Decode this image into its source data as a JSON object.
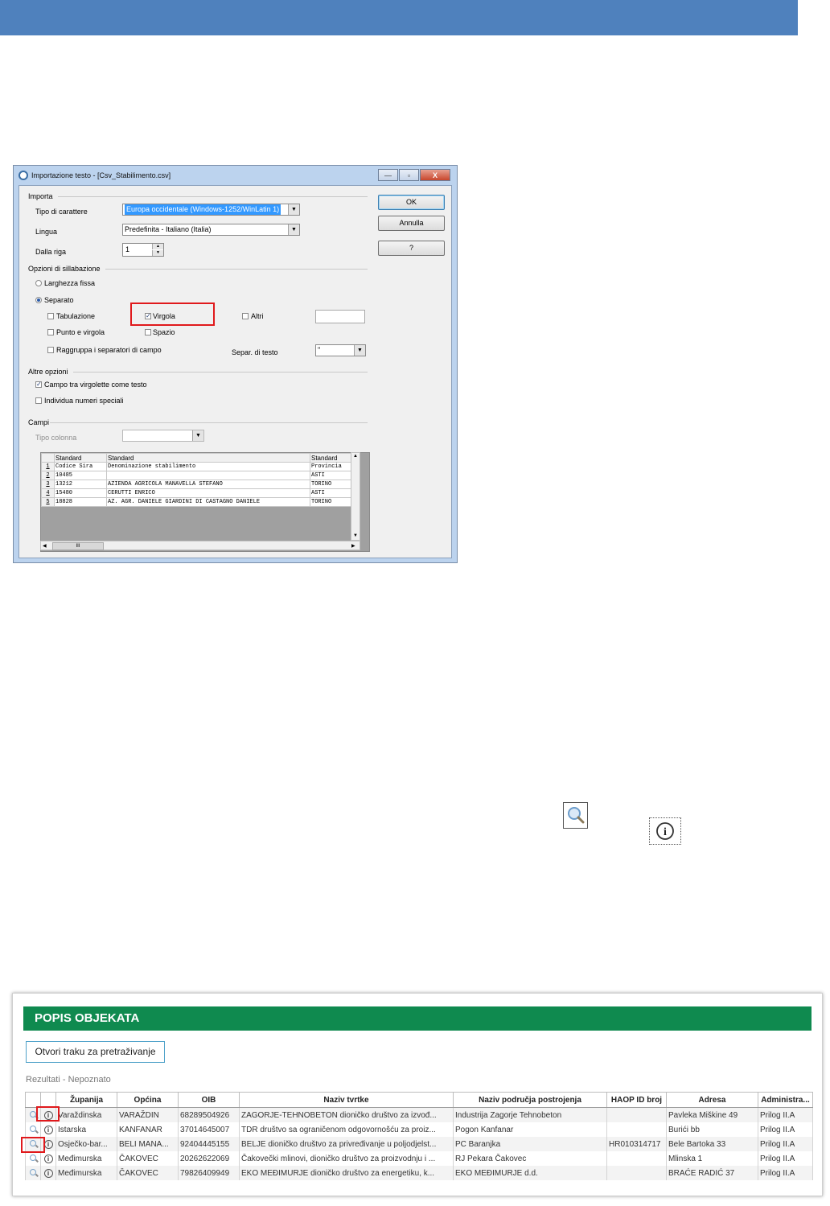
{
  "dialog": {
    "title": "Importazione testo - [Csv_Stabilimento.csv]",
    "window_buttons": {
      "minimize": "—",
      "maximize": "▫",
      "close": "X"
    },
    "importa": {
      "section": "Importa",
      "charset_label": "Tipo di carattere",
      "charset_value": "Europa occidentale (Windows-1252/WinLatin 1)",
      "language_label": "Lingua",
      "language_value": "Predefinita - Italiano (Italia)",
      "from_row_label": "Dalla riga",
      "from_row_value": "1"
    },
    "buttons": {
      "ok": "OK",
      "cancel": "Annulla",
      "help": "?"
    },
    "separator_options": {
      "section": "Opzioni di sillabazione",
      "fixed_width": "Larghezza fissa",
      "separated": "Separato",
      "tab": "Tabulazione",
      "comma": "Virgola",
      "other": "Altri",
      "semicolon": "Punto e virgola",
      "space": "Spazio",
      "merge": "Raggruppa i separatori di campo",
      "text_sep_label": "Separ. di testo",
      "text_sep_value": "\""
    },
    "other_options": {
      "section": "Altre opzioni",
      "quoted_as_text": "Campo tra virgolette come testo",
      "detect_special": "Individua numeri speciali"
    },
    "fields": {
      "section": "Campi",
      "column_type_label": "Tipo colonna"
    },
    "preview": {
      "headers": [
        "Standard",
        "Standard",
        "Standard"
      ],
      "rows": [
        {
          "n": "1",
          "cells": [
            "Codice Sira",
            "Denominazione stabilimento",
            "Provincia"
          ]
        },
        {
          "n": "2",
          "cells": [
            "10485",
            "",
            "ASTI"
          ]
        },
        {
          "n": "3",
          "cells": [
            "13212",
            "AZIENDA AGRICOLA MANAVELLA STEFANO",
            "TORINO"
          ]
        },
        {
          "n": "4",
          "cells": [
            "15480",
            "CERUTTI ENRICO",
            "ASTI"
          ]
        },
        {
          "n": "5",
          "cells": [
            "18828",
            "AZ. AGR. DANIELE GIARDINI DI CASTAGNO DANIELE",
            "TORINO"
          ]
        }
      ],
      "hscroll_grip": "III"
    }
  },
  "popis": {
    "title": "POPIS OBJEKATA",
    "search_button": "Otvori traku za pretraživanje",
    "results_label": "Rezultati - Nepoznato",
    "columns": [
      "",
      "",
      "Županija",
      "Općina",
      "OIB",
      "Naziv tvrtke",
      "Naziv područja postrojenja",
      "HAOP ID broj",
      "Adresa",
      "Administra..."
    ],
    "rows": [
      {
        "zupanija": "Varaždinska",
        "opcina": "VARAŽDIN",
        "oib": "68289504926",
        "naziv": "ZAGORJE-TEHNOBETON dioničko društvo za izvođ...",
        "podrucje": "Industrija Zagorje Tehnobeton",
        "haop": "",
        "adresa": "Pavleka Miškine 49",
        "admin": "Prilog II.A"
      },
      {
        "zupanija": "Istarska",
        "opcina": "KANFANAR",
        "oib": "37014645007",
        "naziv": "TDR društvo sa ograničenom odgovornošću za proiz...",
        "podrucje": "Pogon Kanfanar",
        "haop": "",
        "adresa": "Burići bb",
        "admin": "Prilog II.A"
      },
      {
        "zupanija": "Osječko-bar...",
        "opcina": "BELI MANA...",
        "oib": "92404445155",
        "naziv": "BELJE dioničko društvo za privređivanje u poljodjelst...",
        "podrucje": "PC Baranjka",
        "haop": "HR010314717",
        "adresa": "Bele Bartoka 33",
        "admin": "Prilog II.A"
      },
      {
        "zupanija": "Međimurska",
        "opcina": "ČAKOVEC",
        "oib": "20262622069",
        "naziv": "Čakovečki mlinovi, dioničko društvo za proizvodnju i ...",
        "podrucje": "RJ Pekara Čakovec",
        "haop": "",
        "adresa": "Mlinska 1",
        "admin": "Prilog II.A"
      },
      {
        "zupanija": "Međimurska",
        "opcina": "ČAKOVEC",
        "oib": "79826409949",
        "naziv": "EKO MEĐIMURJE dioničko društvo za energetiku, k...",
        "podrucje": "EKO MEĐIMURJE d.d.",
        "haop": "",
        "adresa": "BRAĆE RADIĆ 37",
        "admin": "Prilog II.A"
      }
    ]
  },
  "icons": {
    "info_glyph": "i"
  },
  "colors": {
    "top_bar": "#4f81bd",
    "panel_header": "#0f8a4f",
    "highlight": "#e0191c",
    "selection": "#3399ff"
  }
}
